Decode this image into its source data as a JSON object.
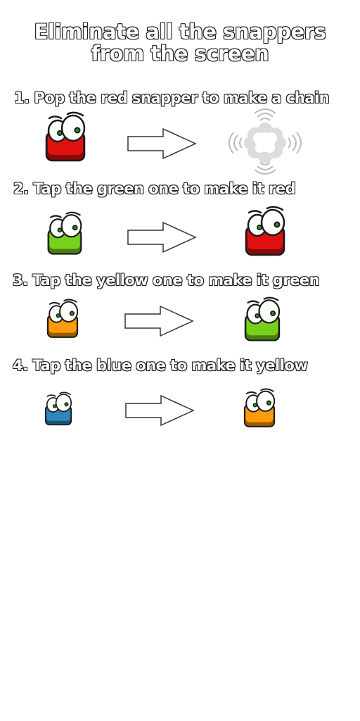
{
  "title_line1": "Eliminate all the snappers",
  "title_line2": "from the screen",
  "colors": {
    "red": "#e01010",
    "green": "#77d11c",
    "yellow": "#ff9a0a",
    "blue": "#2f86b8",
    "outline": "#1a1a1a"
  },
  "steps": [
    {
      "label": "1. Pop the red snapper to make a chain",
      "from": "red",
      "to": "pop-burst"
    },
    {
      "label": "2. Tap the green one to make it red",
      "from": "green",
      "to": "red"
    },
    {
      "label": "3. Tap the yellow one to make it green",
      "from": "yellow",
      "to": "green"
    },
    {
      "label": "4. Tap the blue one to make it yellow",
      "from": "blue",
      "to": "yellow"
    }
  ]
}
